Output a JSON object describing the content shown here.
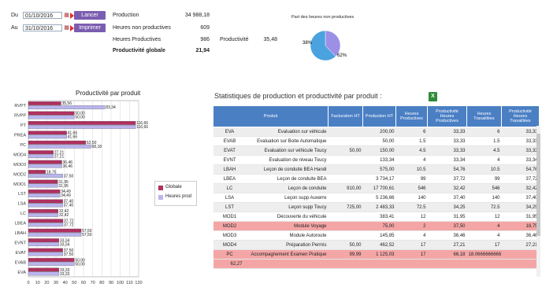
{
  "filters": {
    "du_label": "Du",
    "du_value": "01/10/2016",
    "au_label": "Au",
    "au_value": "31/10/2016",
    "lancer_label": "Lancer",
    "imprimer_label": "Imprimer"
  },
  "summary": {
    "production_label": "Production",
    "production_value": "34 988,18",
    "hnp_label": "Heures non productives",
    "hnp_value": "609",
    "hp_label": "Heures Productives",
    "hp_value": "986",
    "prod_label": "Productivité",
    "prod_value": "35,48",
    "pg_label": "Productivité globale",
    "pg_value": "21,94"
  },
  "pie": {
    "title": "Part des heures non productives",
    "label_a": "38%",
    "label_b": "62%",
    "values": [
      38,
      62
    ],
    "colors": [
      "#9b8fe6",
      "#4aa3df"
    ]
  },
  "chart_data": {
    "type": "bar",
    "title": "Productivité par produit",
    "categories": [
      "RVPT",
      "RVPP",
      "PT",
      "PREA",
      "PC",
      "MOD4",
      "MOD3",
      "MOD2",
      "MOD1",
      "LST",
      "LSA",
      "LC",
      "LBEA",
      "LBAH",
      "EVNT",
      "EVAT",
      "EVAB",
      "EVA"
    ],
    "series": [
      {
        "name": "Globale",
        "color": "#b03060",
        "values": [
          35.56,
          50.0,
          116.66,
          41.66,
          62.5,
          27.21,
          36.46,
          18.75,
          31.95,
          34.49,
          37.4,
          32.42,
          37.72,
          57.5,
          33.34,
          37.5,
          50.0,
          33.33
        ]
      },
      {
        "name": "Heures prod",
        "color": "#b9b5ee",
        "values": [
          83.34,
          50.0,
          116.66,
          41.66,
          68.18,
          27.21,
          36.46,
          37.5,
          31.95,
          34.49,
          37.4,
          32.42,
          37.72,
          57.5,
          33.34,
          37.5,
          50.0,
          33.33
        ]
      }
    ],
    "value_labels": [
      [
        "35,56",
        "83,34"
      ],
      [
        "50,00",
        "50,00"
      ],
      [
        "116,66",
        "116,66"
      ],
      [
        "41,66",
        "41,66"
      ],
      [
        "62,50",
        "68,18"
      ],
      [
        "27,21",
        "27,21"
      ],
      [
        "36,46",
        "36,46"
      ],
      [
        "18,75",
        "37,50"
      ],
      [
        "31,95",
        "31,95"
      ],
      [
        "34,49",
        "34,49"
      ],
      [
        "37,40",
        "37,40"
      ],
      [
        "32,42",
        "32,42"
      ],
      [
        "37,72",
        "37,72"
      ],
      [
        "57,50",
        "57,50"
      ],
      [
        "33,34",
        "33,34"
      ],
      [
        "37,50",
        "37,50"
      ],
      [
        "50,00",
        "50,00"
      ],
      [
        "33,33",
        "33,33"
      ]
    ],
    "xlim": [
      0,
      120
    ],
    "xticks": [
      "0",
      "10",
      "20",
      "30",
      "40",
      "50",
      "60",
      "70",
      "80",
      "90",
      "100",
      "110",
      "120"
    ],
    "grid": true,
    "legend_placement": "right"
  },
  "stats": {
    "title": "Statistiques de production et productivité par produit :",
    "export_icon": "excel-icon",
    "headers": [
      "Produit",
      "Facturation HT",
      "Production HT",
      "Heures Productives",
      "Productivité Heures Productives",
      "Heures Travaillées",
      "Productivité Heures Travaillées"
    ],
    "rows": [
      {
        "code": "EVA",
        "produit": "Evaluation sur véhicule",
        "fact": "",
        "prod": "200,00",
        "hp": "6",
        "php": "33,33",
        "ht": "6",
        "pht": "33,33",
        "style": "alt"
      },
      {
        "code": "EVAB",
        "produit": "Evaluation sur Boite Automatique",
        "fact": "",
        "prod": "50,00",
        "hp": "1.5",
        "php": "33,33",
        "ht": "1.5",
        "pht": "33,33",
        "style": ""
      },
      {
        "code": "EVAT",
        "produit": "Evaluation sur véhicule Toucy",
        "fact": "50,00",
        "prod": "150,00",
        "hp": "4.5",
        "php": "33,33",
        "ht": "4.5",
        "pht": "33,33",
        "style": "alt"
      },
      {
        "code": "EVNT",
        "produit": "Evaluation de niveau Toucy",
        "fact": "",
        "prod": "133,34",
        "hp": "4",
        "php": "33,34",
        "ht": "4",
        "pht": "33,34",
        "style": ""
      },
      {
        "code": "LBAH",
        "produit": "Leçon de conduite BEA Handi",
        "fact": "",
        "prod": "575,00",
        "hp": "10.5",
        "php": "54,76",
        "ht": "10.5",
        "pht": "54,76",
        "style": "alt"
      },
      {
        "code": "LBEA",
        "produit": "Leçon de conduite BEA",
        "fact": "",
        "prod": "3 734,17",
        "hp": "99",
        "php": "37,72",
        "ht": "99",
        "pht": "37,72",
        "style": ""
      },
      {
        "code": "LC",
        "produit": "Leçon de conduite",
        "fact": "910,00",
        "prod": "17 700,61",
        "hp": "546",
        "php": "32,42",
        "ht": "546",
        "pht": "32,42",
        "style": "alt"
      },
      {
        "code": "LSA",
        "produit": "Leçon supp Auxerre",
        "fact": "",
        "prod": "5 236,66",
        "hp": "140",
        "php": "37,40",
        "ht": "140",
        "pht": "37,40",
        "style": ""
      },
      {
        "code": "LST",
        "produit": "Leçon supp Toucy",
        "fact": "725,00",
        "prod": "2 483,33",
        "hp": "72.5",
        "php": "34,25",
        "ht": "72.5",
        "pht": "34,25",
        "style": "alt"
      },
      {
        "code": "MOD1",
        "produit": "Découverte du véhicule",
        "fact": "",
        "prod": "383,41",
        "hp": "12",
        "php": "31,95",
        "ht": "12",
        "pht": "31,95",
        "style": ""
      },
      {
        "code": "MOD2",
        "produit": "Module Voyage",
        "fact": "",
        "prod": "75,00",
        "hp": "2",
        "php": "37,50",
        "ht": "4",
        "pht": "18,75",
        "style": "red"
      },
      {
        "code": "MOD3",
        "produit": "Module Autoroute",
        "fact": "",
        "prod": "145,85",
        "hp": "4",
        "php": "36,46",
        "ht": "4",
        "pht": "36,46",
        "style": ""
      },
      {
        "code": "MOD4",
        "produit": "Préparation Permis",
        "fact": "50,00",
        "prod": "462,52",
        "hp": "17",
        "php": "27,21",
        "ht": "17",
        "pht": "27,21",
        "style": "alt"
      },
      {
        "code": "PC",
        "produit": "Accompagnement Examen Pratique",
        "fact": "99,99",
        "prod": "1 125,03",
        "hp": "17",
        "php": "66,18",
        "ht": "18.06666666667",
        "pht": "",
        "style": "red",
        "extra": "62,27"
      }
    ]
  }
}
